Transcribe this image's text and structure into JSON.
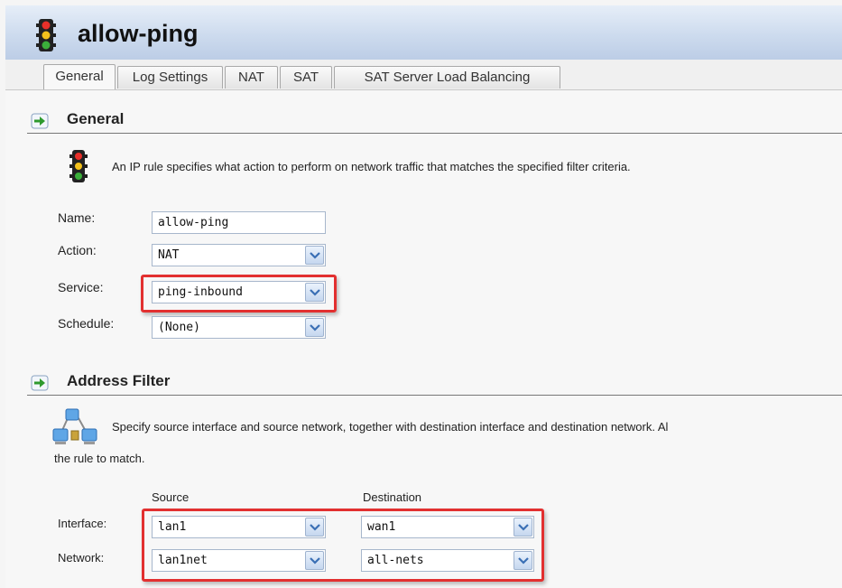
{
  "window": {
    "title": "allow-ping"
  },
  "tabs": [
    {
      "label": "General",
      "active": true
    },
    {
      "label": "Log Settings",
      "active": false
    },
    {
      "label": "NAT",
      "active": false
    },
    {
      "label": "SAT",
      "active": false
    },
    {
      "label": "SAT Server Load Balancing",
      "active": false
    }
  ],
  "general": {
    "heading": "General",
    "description": "An IP rule specifies what action to perform on network traffic that matches the specified filter criteria.",
    "fields": {
      "name": {
        "label": "Name:",
        "value": "allow-ping"
      },
      "action": {
        "label": "Action:",
        "value": "NAT"
      },
      "service": {
        "label": "Service:",
        "value": "ping-inbound"
      },
      "schedule": {
        "label": "Schedule:",
        "value": "(None)"
      }
    }
  },
  "address_filter": {
    "heading": "Address Filter",
    "description_line1": "Specify source interface and source network, together with destination interface and destination network. Al",
    "description_line2": "the rule to match.",
    "columns": {
      "source": "Source",
      "destination": "Destination"
    },
    "rows": {
      "interface": {
        "label": "Interface:",
        "source": "lan1",
        "destination": "wan1"
      },
      "network": {
        "label": "Network:",
        "source": "lan1net",
        "destination": "all-nets"
      }
    }
  },
  "icons": {
    "title": "traffic-light-icon",
    "section": "arrow-right-icon",
    "description": "traffic-light-icon",
    "address": "network-computers-icon",
    "dropdown": "chevron-down-icon"
  },
  "colors": {
    "highlight": "#e23030",
    "titlebar": "#cddbee",
    "dropdown_arrow": "#3a6fb5"
  }
}
